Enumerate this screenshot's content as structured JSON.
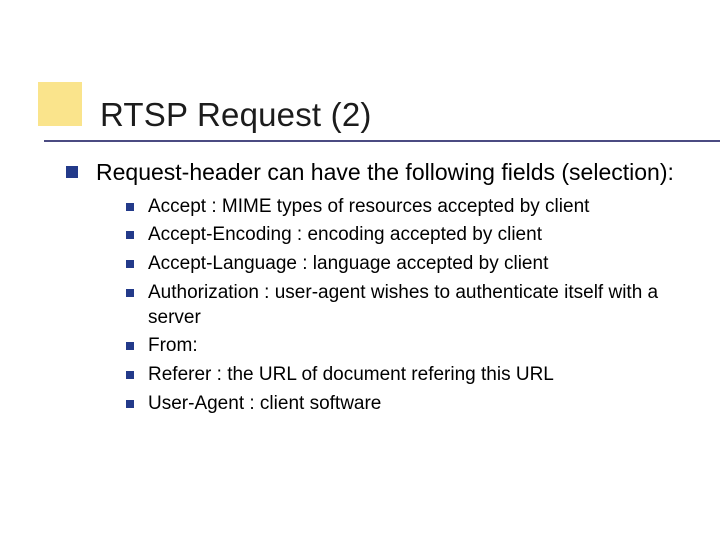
{
  "title": "RTSP Request (2)",
  "main_point": "Request-header can have the following fields (selection):",
  "sub_points": [
    "Accept : MIME types of resources accepted by client",
    "Accept-Encoding : encoding accepted by client",
    "Accept-Language : language accepted by client",
    "Authorization : user-agent wishes to authenticate itself with a server",
    "From:",
    "Referer : the URL of document refering this URL",
    "User-Agent : client software"
  ],
  "colors": {
    "accent_yellow": "#f5c400",
    "bullet_blue": "#233a8a",
    "rule_navy": "#2c2c6c"
  }
}
